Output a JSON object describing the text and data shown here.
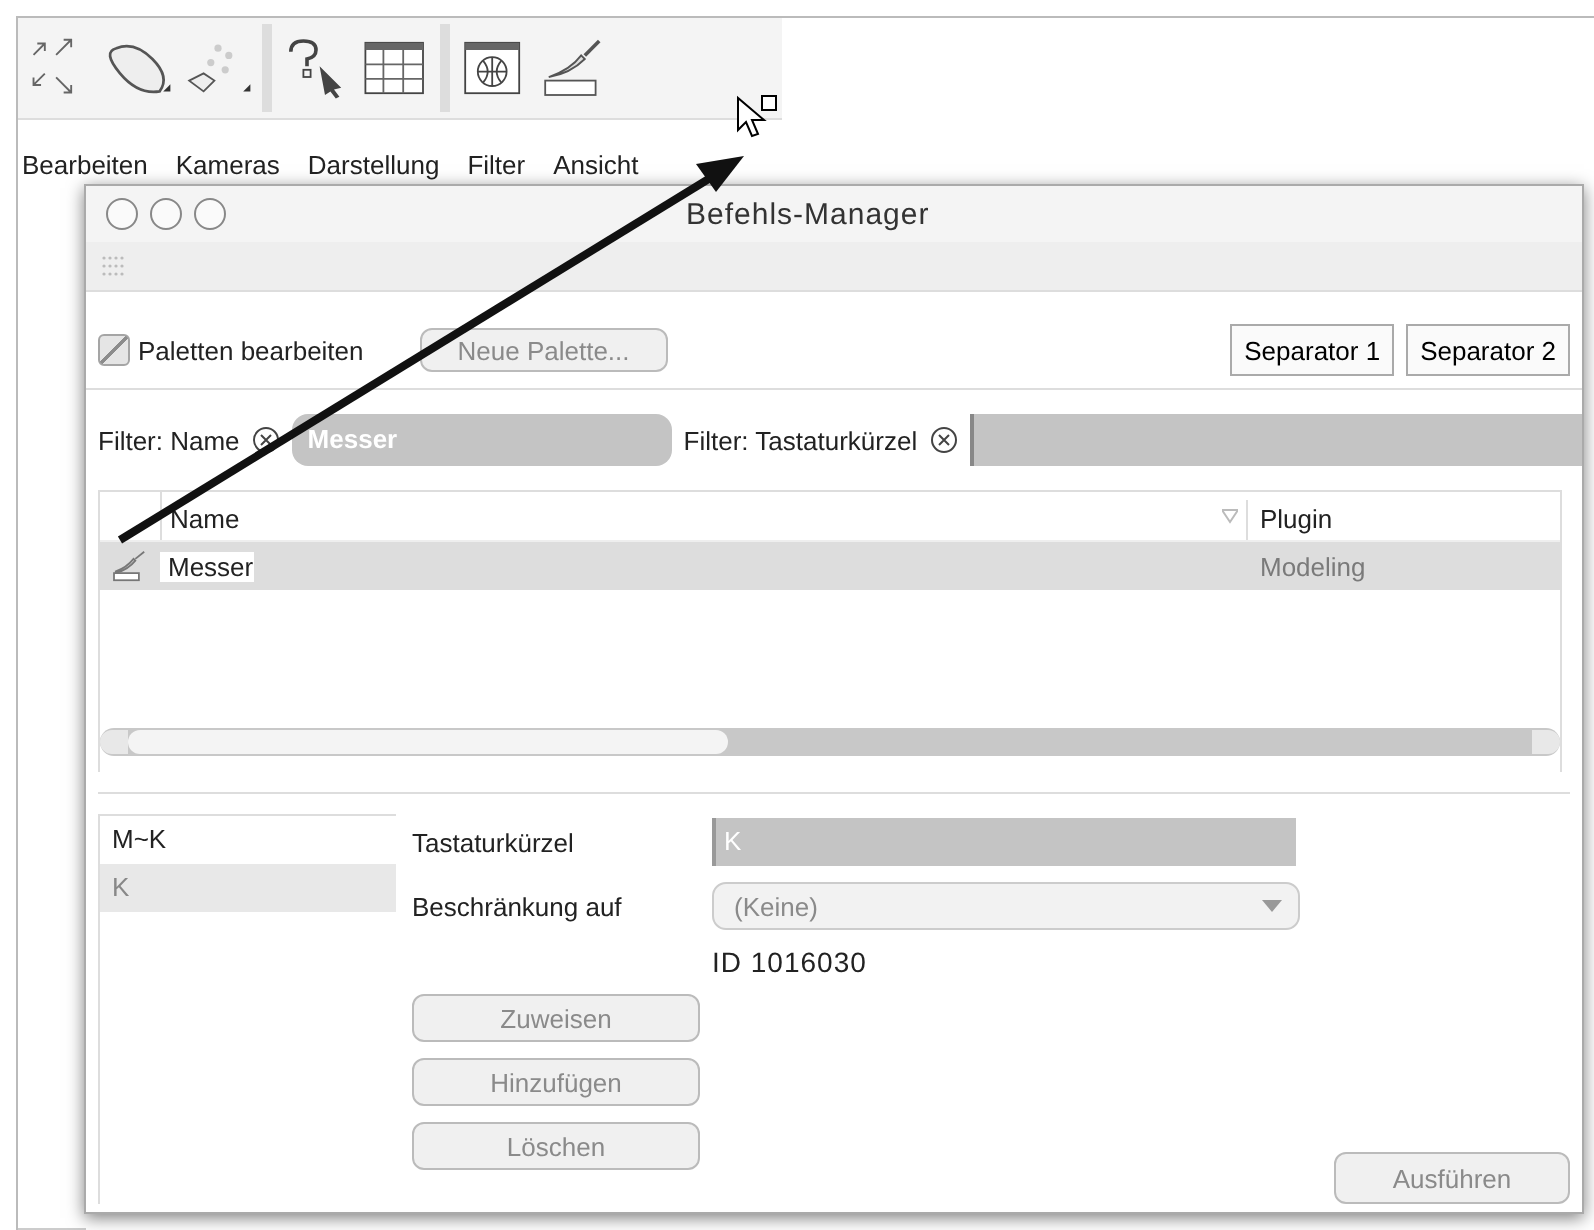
{
  "menu": [
    "Bearbeiten",
    "Kameras",
    "Darstellung",
    "Filter",
    "Ansicht"
  ],
  "window": {
    "title": "Befehls-Manager"
  },
  "palette_checkbox": {
    "label": "Paletten bearbeiten",
    "checked": true,
    "disabled": true
  },
  "new_palette_button": {
    "label": "Neue Palette...",
    "disabled": true
  },
  "separator_buttons": [
    "Separator 1",
    "Separator 2"
  ],
  "filters": [
    {
      "label": "Filter: Name",
      "value": "Messer"
    },
    {
      "label": "Filter: Tastaturkürzel"
    }
  ],
  "table": {
    "columns": [
      "Name",
      "Plugin"
    ],
    "rows": [
      {
        "name": "Messer",
        "plugin": "Modeling",
        "selected": true
      }
    ]
  },
  "shortcut_list": [
    {
      "label": "M~K",
      "selected": false
    },
    {
      "label": "K",
      "selected": true
    }
  ],
  "shortcut_field": {
    "label": "Tastaturkürzel",
    "value": "K"
  },
  "restriction": {
    "label": "Beschränkung auf",
    "value": "(Keine)",
    "disabled": true
  },
  "command_id": "ID 1016030",
  "action_buttons": [
    {
      "label": "Zuweisen",
      "disabled": true
    },
    {
      "label": "Hinzufügen",
      "disabled": true
    },
    {
      "label": "Löschen",
      "disabled": true
    }
  ],
  "run_button": {
    "label": "Ausführen",
    "disabled": true
  }
}
